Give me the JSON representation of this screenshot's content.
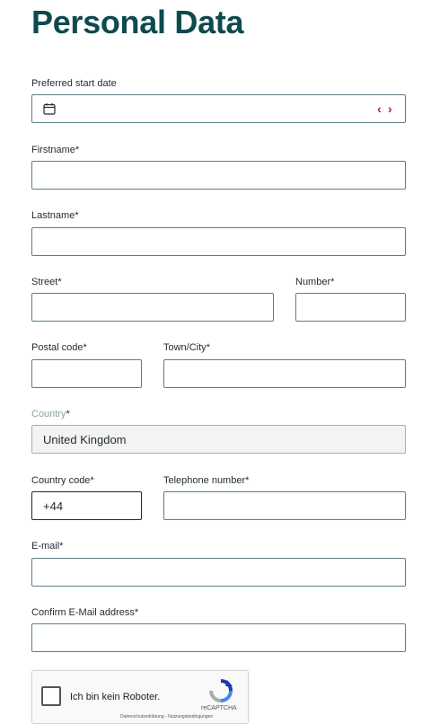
{
  "page": {
    "title": "Personal Data"
  },
  "form": {
    "start_date": {
      "label": "Preferred start date",
      "value": ""
    },
    "firstname": {
      "label": "Firstname",
      "required": "*",
      "value": ""
    },
    "lastname": {
      "label": "Lastname",
      "required": "*",
      "value": ""
    },
    "street": {
      "label": "Street",
      "required": "*",
      "value": ""
    },
    "number": {
      "label": "Number",
      "required": "*",
      "value": ""
    },
    "postal_code": {
      "label": "Postal code",
      "required": "*",
      "value": ""
    },
    "town": {
      "label": "Town/City",
      "required": "*",
      "value": ""
    },
    "country": {
      "label": "Country",
      "required": "*",
      "value": "United Kingdom"
    },
    "country_code": {
      "label": "Country code",
      "required": "*",
      "value": "+44"
    },
    "telephone": {
      "label": "Telephone number",
      "required": "*",
      "value": ""
    },
    "email": {
      "label": "E-mail",
      "required": "*",
      "value": ""
    },
    "confirm_email": {
      "label": "Confirm E-Mail address",
      "required": "*",
      "value": ""
    }
  },
  "captcha": {
    "label": "Ich bin kein Roboter.",
    "brand": "reCAPTCHA",
    "links": "Datenschutzerklärung - Nutzungsbedingungen"
  },
  "icons": {
    "calendar": "calendar-icon",
    "prev": "chevron-left-icon",
    "next": "chevron-right-icon",
    "recaptcha": "recaptcha-logo-icon"
  },
  "colors": {
    "title": "#0d4a4f",
    "border": "#5a7f86",
    "accent": "#b0212c",
    "disabled_bg": "#f3f3f3"
  }
}
